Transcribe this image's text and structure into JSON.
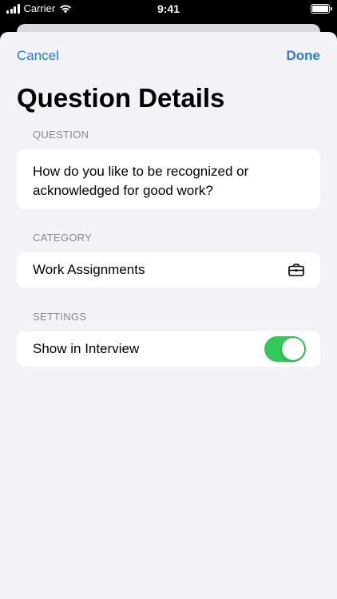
{
  "status_bar": {
    "carrier": "Carrier",
    "time": "9:41"
  },
  "nav": {
    "cancel_label": "Cancel",
    "done_label": "Done",
    "accent_color": "#2b7ccb"
  },
  "page_title": "Question Details",
  "question_section": {
    "header": "QUESTION",
    "text": "How do you like to be recognized or acknowledged for good work?"
  },
  "category_section": {
    "header": "CATEGORY",
    "value": "Work Assignments",
    "icon": "briefcase-icon"
  },
  "settings_section": {
    "header": "SETTINGS",
    "show_in_interview_label": "Show in Interview",
    "show_in_interview_on": true,
    "toggle_color": "#34c759"
  }
}
